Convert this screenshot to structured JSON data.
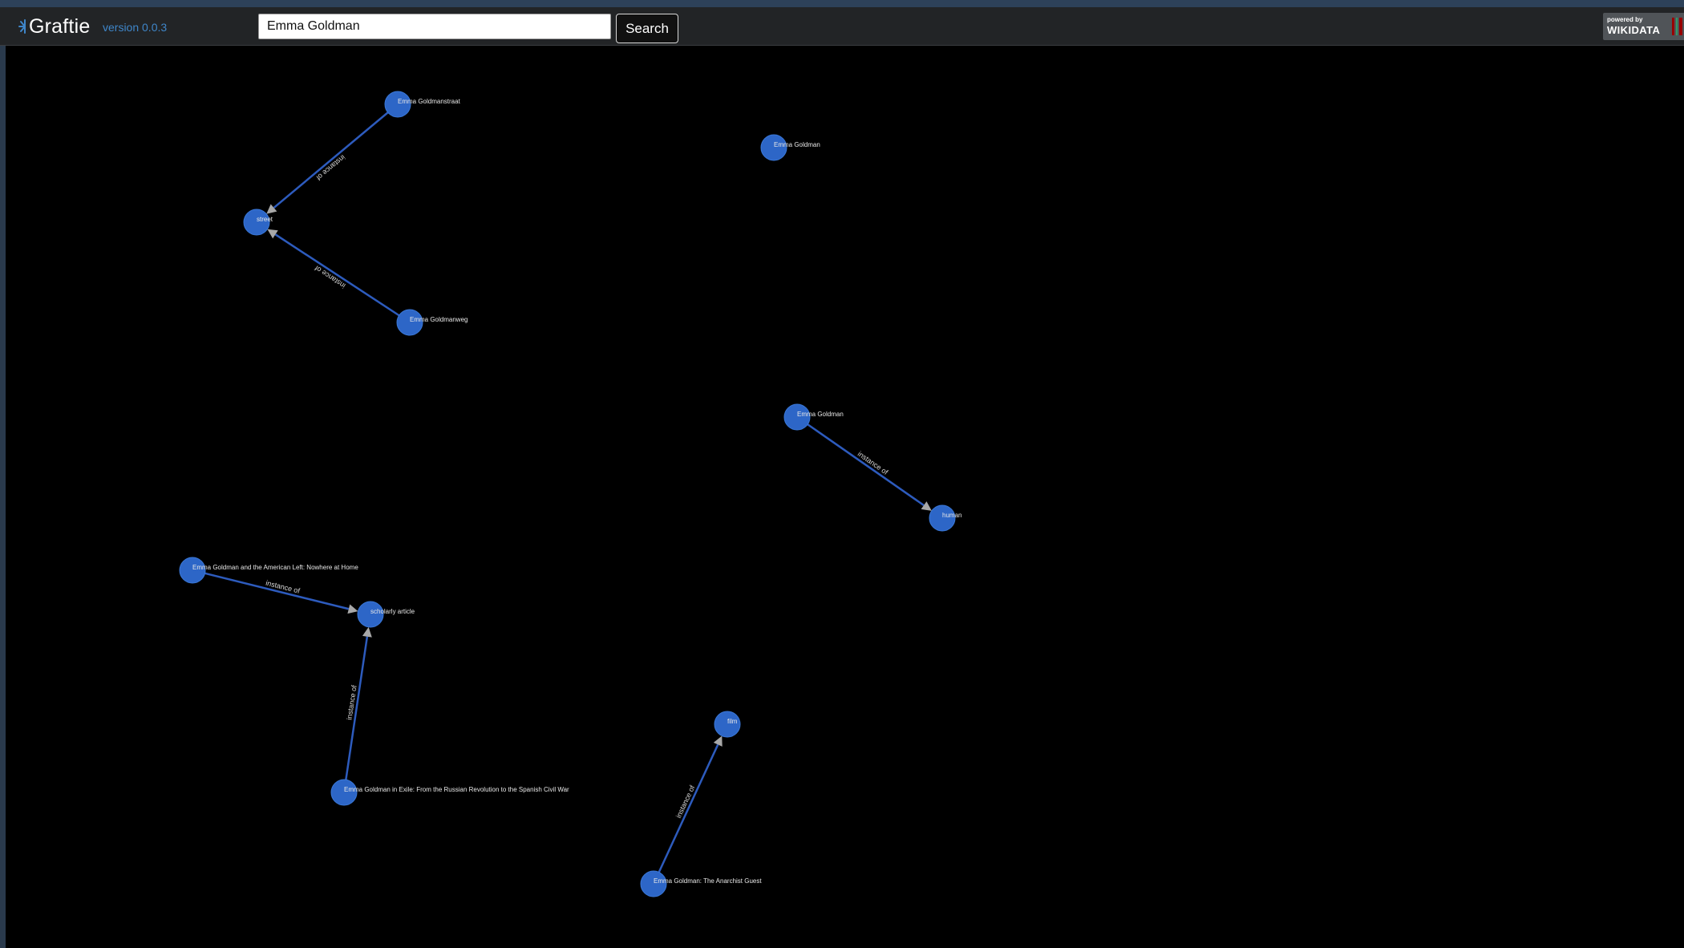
{
  "app": {
    "name": "Graftie",
    "version": "version 0.0.3",
    "logo_icon": "graftie-sparkle-icon"
  },
  "search": {
    "value": "Emma Goldman",
    "button_label": "Search"
  },
  "badge": {
    "powered_by": "powered by",
    "name": "WIKIDATA",
    "icon": "wikidata-barcode-icon"
  },
  "colors": {
    "node_fill": "#2d66c7",
    "edge": "#2d5bbd",
    "arrow": "#a8a8a8",
    "canvas": "#000000",
    "version_text": "#3f86c9"
  },
  "graph": {
    "nodes": [
      {
        "id": "n1",
        "label": "Emma Goldmanstraat"
      },
      {
        "id": "n2",
        "label": "street"
      },
      {
        "id": "n3",
        "label": "Emma Goldmanweg"
      },
      {
        "id": "n4",
        "label": "Emma Goldman"
      },
      {
        "id": "n5",
        "label": "Emma Goldman"
      },
      {
        "id": "n6",
        "label": "human"
      },
      {
        "id": "n7",
        "label": "Emma Goldman and the American Left: Nowhere at Home"
      },
      {
        "id": "n8",
        "label": "scholarly article"
      },
      {
        "id": "n9",
        "label": "Emma Goldman in Exile: From the Russian Revolution to the Spanish Civil War"
      },
      {
        "id": "n10",
        "label": "film"
      },
      {
        "id": "n11",
        "label": "Emma Goldman: The Anarchist Guest"
      }
    ],
    "edges": [
      {
        "source": "n1",
        "target": "n2",
        "label": "instance of"
      },
      {
        "source": "n3",
        "target": "n2",
        "label": "instance of"
      },
      {
        "source": "n5",
        "target": "n6",
        "label": "instance of"
      },
      {
        "source": "n7",
        "target": "n8",
        "label": "instance of"
      },
      {
        "source": "n9",
        "target": "n8",
        "label": "instance of"
      },
      {
        "source": "n11",
        "target": "n10",
        "label": "instance of"
      }
    ]
  }
}
